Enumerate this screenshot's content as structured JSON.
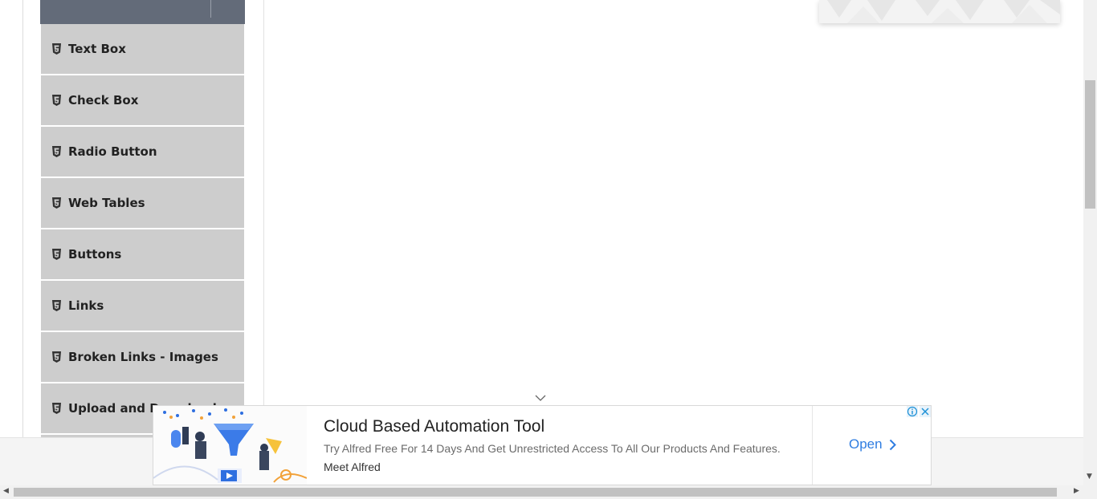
{
  "sidebar": {
    "items": [
      {
        "label": "Text Box",
        "icon": "html5-icon"
      },
      {
        "label": "Check Box",
        "icon": "html5-icon"
      },
      {
        "label": "Radio Button",
        "icon": "html5-icon"
      },
      {
        "label": "Web Tables",
        "icon": "html5-icon"
      },
      {
        "label": "Buttons",
        "icon": "html5-icon"
      },
      {
        "label": "Links",
        "icon": "html5-icon"
      },
      {
        "label": "Broken Links - Images",
        "icon": "html5-icon"
      },
      {
        "label": "Upload and Download",
        "icon": "html5-icon"
      }
    ]
  },
  "ad": {
    "title": "Cloud Based Automation Tool",
    "description": "Try Alfred Free For 14 Days And Get Unrestricted Access To All Our Products And Features.",
    "advertiser": "Meet Alfred",
    "cta": "Open",
    "accent_color": "#2f7de1"
  },
  "colors": {
    "sidebar_header": "#636b79",
    "sidebar_item": "#cdcdcd"
  }
}
